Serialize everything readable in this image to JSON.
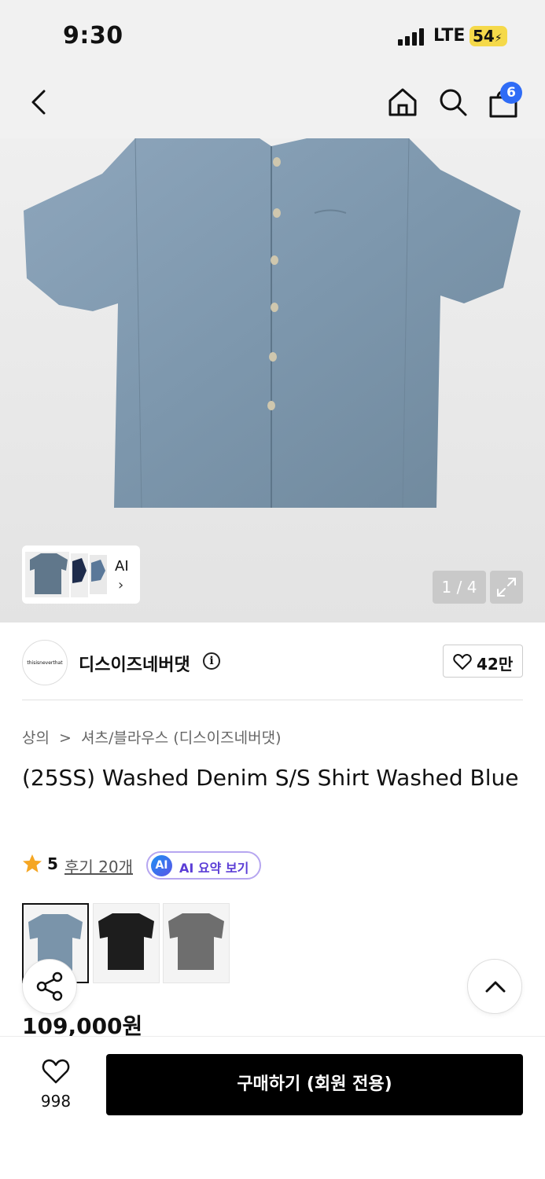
{
  "status": {
    "time": "9:30",
    "network": "LTE",
    "battery": "54"
  },
  "nav": {
    "cart_count": "6"
  },
  "gallery": {
    "ai_label": "AI",
    "pager": "1 / 4"
  },
  "brand": {
    "logo_text": "thisisneverthat",
    "name": "디스이즈네버댓",
    "likes": "42만"
  },
  "breadcrumb": {
    "category": "상의",
    "sep": ">",
    "subcategory": "셔츠/블라우스 (디스이즈네버댓)"
  },
  "product": {
    "title": "(25SS) Washed Denim S/S Shirt Washed Blue",
    "rating": "5",
    "reviews": "후기 20개",
    "ai_badge": "AI",
    "ai_summary": "AI 요약 보기",
    "price": "109,000원",
    "colors": [
      "Washed Blue",
      "Black",
      "Grey"
    ]
  },
  "bottom": {
    "wish_count": "998",
    "buy_label": "구매하기 (회원 전용)"
  },
  "colors": {
    "accent_blue": "#2f6cf6",
    "ai_purple": "#5b3dd6",
    "star": "#f5a623",
    "button": "#000000"
  }
}
